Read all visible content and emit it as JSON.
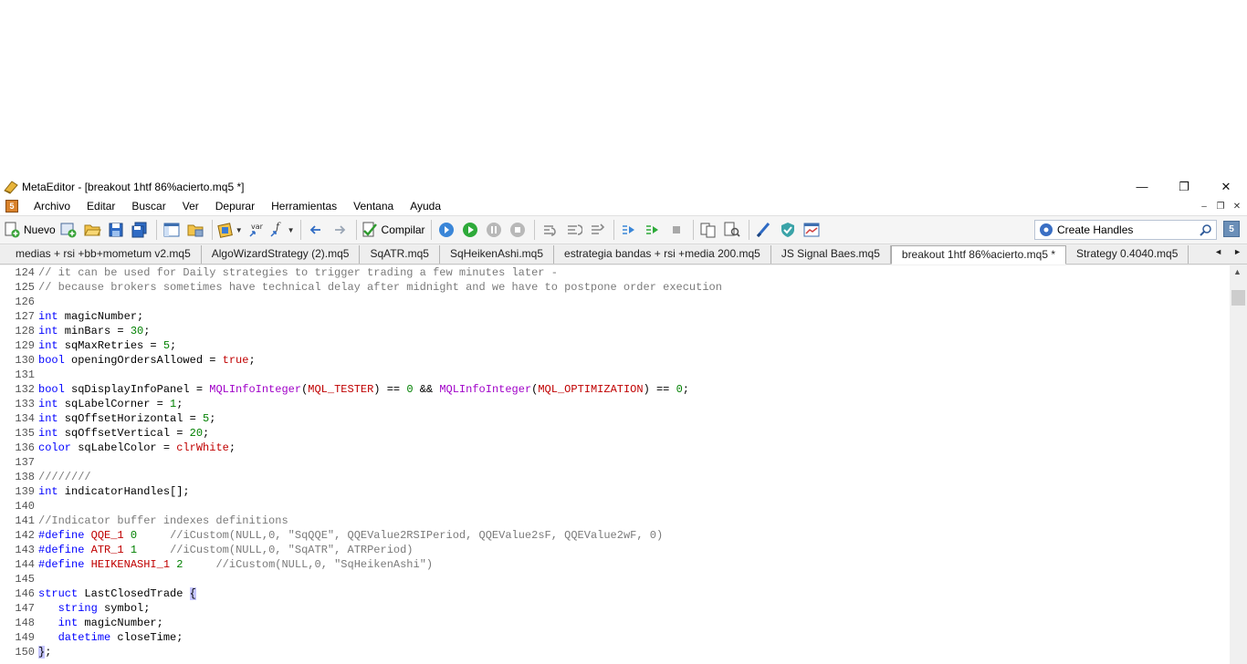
{
  "window": {
    "title": "MetaEditor - [breakout 1htf 86%acierto.mq5 *]"
  },
  "menu": [
    "Archivo",
    "Editar",
    "Buscar",
    "Ver",
    "Depurar",
    "Herramientas",
    "Ventana",
    "Ayuda"
  ],
  "toolbar": {
    "new_label": "Nuevo",
    "compile_label": "Compilar",
    "var_label": "var",
    "search_value": "Create Handles",
    "help_label": "5"
  },
  "tabs": [
    {
      "label": "medias + rsi +bb+mometum v2.mq5",
      "active": false
    },
    {
      "label": "AlgoWizardStrategy (2).mq5",
      "active": false
    },
    {
      "label": "SqATR.mq5",
      "active": false
    },
    {
      "label": "SqHeikenAshi.mq5",
      "active": false
    },
    {
      "label": "estrategia bandas + rsi +media 200.mq5",
      "active": false
    },
    {
      "label": "JS Signal Baes.mq5",
      "active": false
    },
    {
      "label": "breakout 1htf 86%acierto.mq5 *",
      "active": true
    },
    {
      "label": "Strategy 0.4040.mq5",
      "active": false
    }
  ],
  "code_lines": [
    {
      "n": "124",
      "parts": [
        [
          "cm",
          "// it can be used for Daily strategies to trigger trading a few minutes later -"
        ]
      ]
    },
    {
      "n": "125",
      "parts": [
        [
          "cm",
          "// because brokers sometimes have technical delay after midnight and we have to postpone order execution"
        ]
      ]
    },
    {
      "n": "126",
      "parts": []
    },
    {
      "n": "127",
      "parts": [
        [
          "kw",
          "int"
        ],
        [
          "tx",
          " magicNumber;"
        ]
      ]
    },
    {
      "n": "128",
      "parts": [
        [
          "kw",
          "int"
        ],
        [
          "tx",
          " minBars = "
        ],
        [
          "num",
          "30"
        ],
        [
          "tx",
          ";"
        ]
      ]
    },
    {
      "n": "129",
      "parts": [
        [
          "kw",
          "int"
        ],
        [
          "tx",
          " sqMaxRetries = "
        ],
        [
          "num",
          "5"
        ],
        [
          "tx",
          ";"
        ]
      ]
    },
    {
      "n": "130",
      "parts": [
        [
          "kw",
          "bool"
        ],
        [
          "tx",
          " openingOrdersAllowed = "
        ],
        [
          "const",
          "true"
        ],
        [
          "tx",
          ";"
        ]
      ]
    },
    {
      "n": "131",
      "parts": []
    },
    {
      "n": "132",
      "parts": [
        [
          "kw",
          "bool"
        ],
        [
          "tx",
          " sqDisplayInfoPanel = "
        ],
        [
          "fn",
          "MQLInfoInteger"
        ],
        [
          "tx",
          "("
        ],
        [
          "const",
          "MQL_TESTER"
        ],
        [
          "tx",
          ") == "
        ],
        [
          "num",
          "0"
        ],
        [
          "tx",
          " && "
        ],
        [
          "fn",
          "MQLInfoInteger"
        ],
        [
          "tx",
          "("
        ],
        [
          "const",
          "MQL_OPTIMIZATION"
        ],
        [
          "tx",
          ") == "
        ],
        [
          "num",
          "0"
        ],
        [
          "tx",
          ";"
        ]
      ]
    },
    {
      "n": "133",
      "parts": [
        [
          "kw",
          "int"
        ],
        [
          "tx",
          " sqLabelCorner = "
        ],
        [
          "num",
          "1"
        ],
        [
          "tx",
          ";"
        ]
      ]
    },
    {
      "n": "134",
      "parts": [
        [
          "kw",
          "int"
        ],
        [
          "tx",
          " sqOffsetHorizontal = "
        ],
        [
          "num",
          "5"
        ],
        [
          "tx",
          ";"
        ]
      ]
    },
    {
      "n": "135",
      "parts": [
        [
          "kw",
          "int"
        ],
        [
          "tx",
          " sqOffsetVertical = "
        ],
        [
          "num",
          "20"
        ],
        [
          "tx",
          ";"
        ]
      ]
    },
    {
      "n": "136",
      "parts": [
        [
          "kw",
          "color"
        ],
        [
          "tx",
          " sqLabelColor = "
        ],
        [
          "const",
          "clrWhite"
        ],
        [
          "tx",
          ";"
        ]
      ]
    },
    {
      "n": "137",
      "parts": []
    },
    {
      "n": "138",
      "parts": [
        [
          "cm",
          "////////"
        ]
      ]
    },
    {
      "n": "139",
      "parts": [
        [
          "kw",
          "int"
        ],
        [
          "tx",
          " indicatorHandles[];"
        ]
      ]
    },
    {
      "n": "140",
      "parts": []
    },
    {
      "n": "141",
      "parts": [
        [
          "cm",
          "//Indicator buffer indexes definitions"
        ]
      ]
    },
    {
      "n": "142",
      "parts": [
        [
          "kw",
          "#define"
        ],
        [
          "tx",
          " "
        ],
        [
          "const",
          "QQE_1"
        ],
        [
          "tx",
          " "
        ],
        [
          "num",
          "0"
        ],
        [
          "tx",
          "     "
        ],
        [
          "cm",
          "//iCustom(NULL,0, \"SqQQE\", QQEValue2RSIPeriod, QQEValue2sF, QQEValue2wF, 0)"
        ]
      ]
    },
    {
      "n": "143",
      "parts": [
        [
          "kw",
          "#define"
        ],
        [
          "tx",
          " "
        ],
        [
          "const",
          "ATR_1"
        ],
        [
          "tx",
          " "
        ],
        [
          "num",
          "1"
        ],
        [
          "tx",
          "     "
        ],
        [
          "cm",
          "//iCustom(NULL,0, \"SqATR\", ATRPeriod)"
        ]
      ]
    },
    {
      "n": "144",
      "parts": [
        [
          "kw",
          "#define"
        ],
        [
          "tx",
          " "
        ],
        [
          "const",
          "HEIKENASHI_1"
        ],
        [
          "tx",
          " "
        ],
        [
          "num",
          "2"
        ],
        [
          "tx",
          "     "
        ],
        [
          "cm",
          "//iCustom(NULL,0, \"SqHeikenAshi\")"
        ]
      ]
    },
    {
      "n": "145",
      "parts": []
    },
    {
      "n": "146",
      "parts": [
        [
          "kw",
          "struct"
        ],
        [
          "tx",
          " LastClosedTrade "
        ],
        [
          "br",
          "{"
        ]
      ]
    },
    {
      "n": "147",
      "parts": [
        [
          "tx",
          "   "
        ],
        [
          "kw",
          "string"
        ],
        [
          "tx",
          " symbol;"
        ]
      ]
    },
    {
      "n": "148",
      "parts": [
        [
          "tx",
          "   "
        ],
        [
          "kw",
          "int"
        ],
        [
          "tx",
          " magicNumber;"
        ]
      ]
    },
    {
      "n": "149",
      "parts": [
        [
          "tx",
          "   "
        ],
        [
          "kw",
          "datetime"
        ],
        [
          "tx",
          " closeTime;"
        ]
      ]
    },
    {
      "n": "150",
      "parts": [
        [
          "br",
          "}"
        ],
        [
          "tx",
          ";"
        ]
      ]
    }
  ],
  "colors": {
    "keyword": "#0000ff",
    "comment": "#7a7a7a",
    "number": "#008000",
    "function": "#a000c8",
    "constant": "#c00000",
    "bracket_highlight": "#c6c6ff"
  }
}
